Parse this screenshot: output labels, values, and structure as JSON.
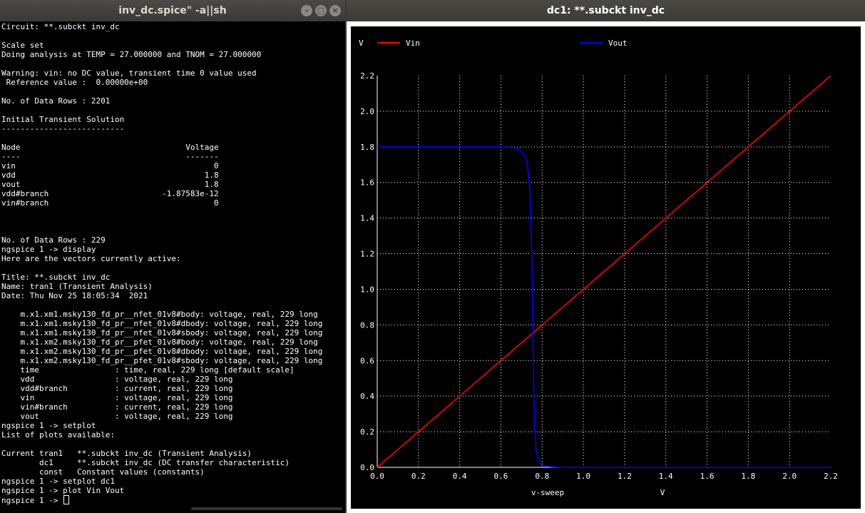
{
  "terminal": {
    "title": "inv_dc.spice\" -a||sh",
    "lines": [
      "Circuit: **.subckt inv_dc",
      "",
      "Scale set",
      "Doing analysis at TEMP = 27.000000 and TNOM = 27.000000",
      "",
      "Warning: vin: no DC value, transient time 0 value used",
      " Reference value :  0.00000e+00",
      "",
      "No. of Data Rows : 2201",
      "",
      "Initial Transient Solution",
      "--------------------------",
      "",
      "Node                                   Voltage",
      "----                                   -------",
      "vin                                          0",
      "vdd                                        1.8",
      "vout                                       1.8",
      "vdd#branch                        -1.87583e-12",
      "vin#branch                                   0",
      "",
      "",
      "",
      "No. of Data Rows : 229",
      "ngspice 1 -> display",
      "Here are the vectors currently active:",
      "",
      "Title: **.subckt inv_dc",
      "Name: tran1 (Transient Analysis)",
      "Date: Thu Nov 25 18:05:34  2021",
      "",
      "    m.x1.xm1.msky130_fd_pr__nfet_01v8#body: voltage, real, 229 long",
      "    m.x1.xm1.msky130_fd_pr__nfet_01v8#dbody: voltage, real, 229 long",
      "    m.x1.xm1.msky130_fd_pr__nfet_01v8#sbody: voltage, real, 229 long",
      "    m.x1.xm2.msky130_fd_pr__pfet_01v8#body: voltage, real, 229 long",
      "    m.x1.xm2.msky130_fd_pr__pfet_01v8#dbody: voltage, real, 229 long",
      "    m.x1.xm2.msky130_fd_pr__pfet_01v8#sbody: voltage, real, 229 long",
      "    time                : time, real, 229 long [default scale]",
      "    vdd                 : voltage, real, 229 long",
      "    vdd#branch          : current, real, 229 long",
      "    vin                 : voltage, real, 229 long",
      "    vin#branch          : current, real, 229 long",
      "    vout                : voltage, real, 229 long",
      "ngspice 1 -> setplot",
      "List of plots available:",
      "",
      "Current tran1   **.subckt inv_dc (Transient Analysis)",
      "        dc1     **.subckt inv_dc (DC transfer characteristic)",
      "        const   Constant values (constants)",
      "ngspice 1 -> setplot dc1",
      "ngspice 1 -> plot Vin Vout"
    ],
    "prompt": "ngspice 1 -> "
  },
  "plot_window": {
    "title": "dc1: **.subckt inv_dc"
  },
  "chart_data": {
    "type": "line",
    "title": "",
    "xlabel": "v-sweep",
    "xunit": "V",
    "ylabel": "V",
    "xlim": [
      0.0,
      2.2
    ],
    "ylim": [
      0.0,
      2.2
    ],
    "xticks": [
      "0.0",
      "0.2",
      "0.4",
      "0.6",
      "0.8",
      "1.0",
      "1.2",
      "1.4",
      "1.6",
      "1.8",
      "2.0",
      "2.2"
    ],
    "yticks": [
      "0.0",
      "0.2",
      "0.4",
      "0.6",
      "0.8",
      "1.0",
      "1.2",
      "1.4",
      "1.6",
      "1.8",
      "2.0",
      "2.2"
    ],
    "grid": true,
    "legend": "top",
    "series": [
      {
        "name": "Vin",
        "color": "#ff0000",
        "x": [
          0.0,
          2.2
        ],
        "y": [
          0.0,
          2.2
        ]
      },
      {
        "name": "Vout",
        "color": "#0000ff",
        "x": [
          0.0,
          0.6,
          0.65,
          0.68,
          0.7,
          0.72,
          0.73,
          0.74,
          0.75,
          0.755,
          0.76,
          0.765,
          0.77,
          0.78,
          0.79,
          0.8,
          0.82,
          0.85,
          0.9,
          1.0,
          1.5,
          2.2
        ],
        "y": [
          1.8,
          1.8,
          1.797,
          1.79,
          1.775,
          1.74,
          1.69,
          1.55,
          1.2,
          0.8,
          0.4,
          0.2,
          0.1,
          0.05,
          0.025,
          0.012,
          0.006,
          0.003,
          0.001,
          0.0,
          0.0,
          0.0
        ]
      }
    ]
  }
}
